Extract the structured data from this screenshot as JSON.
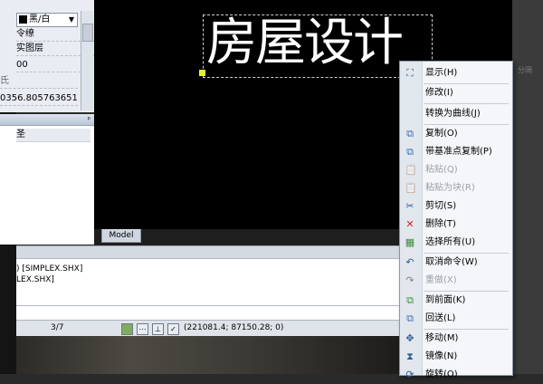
{
  "properties": {
    "color_value": "黑/白",
    "rows": [
      "令缭",
      "实图层",
      "00",
      "氏",
      "0356.805763651"
    ]
  },
  "panel2": {
    "pin": "ᵖ",
    "row_text": "圣"
  },
  "canvas": {
    "text": "房屋设计",
    "model_tab": "Model"
  },
  "right_area": {
    "label": "分隔"
  },
  "command": {
    "lines": [
      ") [SIMPLEX.SHX]",
      "LEX.SHX]"
    ]
  },
  "status": {
    "page": "3/7",
    "coordinates": "(221081.4; 87150.28; 0)"
  },
  "context_menu": {
    "items": [
      {
        "label": "显示(H)",
        "icon": "display-icon",
        "enabled": true
      },
      {
        "label": "修改(I)",
        "icon": "",
        "enabled": true
      },
      {
        "label": "转换为曲线(J)",
        "icon": "",
        "enabled": true
      },
      {
        "label": "复制(O)",
        "icon": "copy-icon",
        "enabled": true
      },
      {
        "label": "带基准点复制(P)",
        "icon": "copy-base-icon",
        "enabled": true
      },
      {
        "label": "粘贴(Q)",
        "icon": "paste-icon",
        "enabled": false
      },
      {
        "label": "粘贴为块(R)",
        "icon": "paste-block-icon",
        "enabled": false
      },
      {
        "label": "剪切(S)",
        "icon": "scissors-icon",
        "enabled": true
      },
      {
        "label": "删除(T)",
        "icon": "delete-icon",
        "enabled": true
      },
      {
        "label": "选择所有(U)",
        "icon": "select-all-icon",
        "enabled": true
      },
      {
        "label": "取消命令(W)",
        "icon": "undo-icon",
        "enabled": true
      },
      {
        "label": "重做(X)",
        "icon": "redo-icon",
        "enabled": false
      },
      {
        "label": "到前面(K)",
        "icon": "bring-front-icon",
        "enabled": true
      },
      {
        "label": "回送(L)",
        "icon": "send-back-icon",
        "enabled": true
      },
      {
        "label": "移动(M)",
        "icon": "move-icon",
        "enabled": true
      },
      {
        "label": "镜像(N)",
        "icon": "mirror-icon",
        "enabled": true
      },
      {
        "label": "旋转(O)",
        "icon": "rotate-icon",
        "enabled": true
      }
    ]
  },
  "colors": {
    "canvas_bg": "#000000",
    "menu_bg": "#f4f6f9",
    "grip": "#e6f02a"
  }
}
